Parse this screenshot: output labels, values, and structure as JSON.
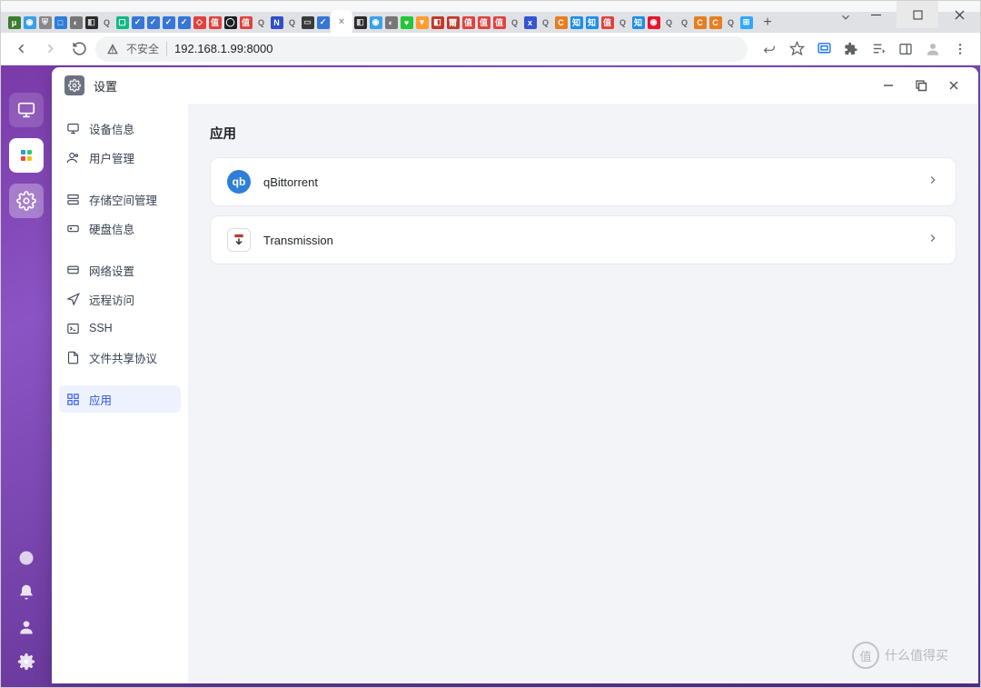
{
  "browser": {
    "unsafe_label": "不安全",
    "url": "192.168.1.99:8000",
    "tabs_count": 49,
    "active_tab_index": 21
  },
  "window": {
    "title": "设置"
  },
  "sidebar": {
    "items": [
      {
        "label": "设备信息",
        "icon": "monitor"
      },
      {
        "label": "用户管理",
        "icon": "user"
      },
      {
        "label": "存储空间管理",
        "icon": "layers"
      },
      {
        "label": "硬盘信息",
        "icon": "hdd"
      },
      {
        "label": "网络设置",
        "icon": "network"
      },
      {
        "label": "远程访问",
        "icon": "nav"
      },
      {
        "label": "SSH",
        "icon": "terminal"
      },
      {
        "label": "文件共享协议",
        "icon": "doc"
      },
      {
        "label": "应用",
        "icon": "grid",
        "active": true
      }
    ]
  },
  "main": {
    "heading": "应用",
    "apps": [
      {
        "name": "qBittorrent",
        "icon_bg": "#2f7ed8",
        "icon_text": "qb"
      },
      {
        "name": "Transmission",
        "icon_bg": "#ffffff",
        "icon_text": "↓"
      }
    ]
  },
  "watermark": {
    "circle": "值",
    "text": "什么值得买"
  }
}
